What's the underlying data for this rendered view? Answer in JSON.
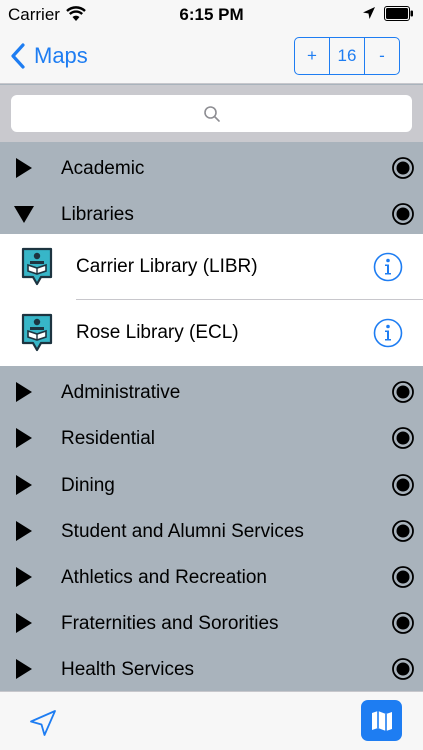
{
  "status_bar": {
    "carrier": "Carrier",
    "time": "6:15 PM"
  },
  "nav": {
    "back_label": "Maps",
    "zoom_in": "+",
    "zoom_level": "16",
    "zoom_out": "-"
  },
  "search": {
    "placeholder": "",
    "value": ""
  },
  "categories": [
    {
      "label": "Academic",
      "expanded": false
    },
    {
      "label": "Libraries",
      "expanded": true
    },
    {
      "label": "Administrative",
      "expanded": false
    },
    {
      "label": "Residential",
      "expanded": false
    },
    {
      "label": "Dining",
      "expanded": false
    },
    {
      "label": "Student and Alumni Services",
      "expanded": false
    },
    {
      "label": "Athletics and Recreation",
      "expanded": false
    },
    {
      "label": "Fraternities and Sororities",
      "expanded": false
    },
    {
      "label": "Health Services",
      "expanded": false
    }
  ],
  "libraries": [
    {
      "label": "Carrier Library (LIBR)",
      "icon": "library-pin-icon"
    },
    {
      "label": "Rose Library (ECL)",
      "icon": "library-pin-icon"
    }
  ],
  "colors": {
    "accent": "#1e7df2",
    "category_bg": "#a9b3bc",
    "icon_teal": "#37b6c8"
  }
}
